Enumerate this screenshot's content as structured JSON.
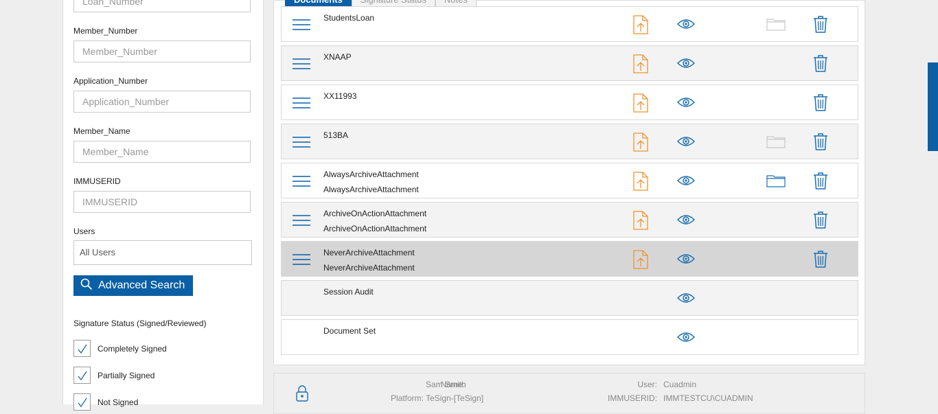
{
  "search_form": {
    "loan_number": {
      "placeholder": "Loan_Number",
      "value": ""
    },
    "member_number": {
      "label": "Member_Number",
      "placeholder": "Member_Number",
      "value": ""
    },
    "application_number": {
      "label": "Application_Number",
      "placeholder": "Application_Number",
      "value": ""
    },
    "member_name": {
      "label": "Member_Name",
      "placeholder": "Member_Name",
      "value": ""
    },
    "immuserid": {
      "label": "IMMUSERID",
      "placeholder": "IMMUSERID",
      "value": ""
    },
    "users": {
      "label": "Users",
      "selected": "All Users"
    },
    "advanced_search_label": "Advanced Search",
    "search_icon": "search-icon"
  },
  "signature_status": {
    "title": "Signature Status (Signed/Reviewed)",
    "options": [
      {
        "label": "Completely Signed",
        "checked": true
      },
      {
        "label": "Partially Signed",
        "checked": true
      },
      {
        "label": "Not Signed",
        "checked": true
      }
    ]
  },
  "tabs": [
    {
      "label": "Documents",
      "active": true
    },
    {
      "label": "Signature Status",
      "active": false
    },
    {
      "label": "Notes",
      "active": false
    }
  ],
  "documents": [
    {
      "name": "StudentsLoan",
      "sub": "",
      "menu": true,
      "upload": true,
      "view": true,
      "folder": "disabled",
      "delete": true
    },
    {
      "name": "XNAAP",
      "sub": "",
      "menu": true,
      "upload": true,
      "view": true,
      "folder": "none",
      "delete": true
    },
    {
      "name": "XX11993",
      "sub": "",
      "menu": true,
      "upload": true,
      "view": true,
      "folder": "none",
      "delete": true
    },
    {
      "name": "513BA",
      "sub": "",
      "menu": true,
      "upload": true,
      "view": true,
      "folder": "disabled",
      "delete": true
    },
    {
      "name": "AlwaysArchiveAttachment",
      "sub": "AlwaysArchiveAttachment",
      "menu": true,
      "upload": true,
      "view": true,
      "folder": "active",
      "delete": true
    },
    {
      "name": "ArchiveOnActionAttachment",
      "sub": "ArchiveOnActionAttachment",
      "menu": true,
      "upload": true,
      "view": true,
      "folder": "none",
      "delete": true
    },
    {
      "name": "NeverArchiveAttachment",
      "sub": "NeverArchiveAttachment",
      "menu": true,
      "upload": true,
      "view": true,
      "folder": "none",
      "delete": true,
      "selected": true
    },
    {
      "name": "Session Audit",
      "sub": "",
      "menu": false,
      "upload": false,
      "view": true,
      "folder": "none",
      "delete": false
    },
    {
      "name": "Document Set",
      "sub": "",
      "menu": false,
      "upload": false,
      "view": true,
      "folder": "none",
      "delete": false
    }
  ],
  "footer": {
    "name_label": "Name:",
    "name_value": "Sam Smith",
    "platform_label": "Platform:",
    "platform_value": "TeSign-[TeSign]",
    "user_label": "User:",
    "user_value": "Cuadmin",
    "immuserid_label": "IMMUSERID:",
    "immuserid_value": "IMMTESTCU\\CUADMIN"
  },
  "colors": {
    "accent": "#0b5fa5",
    "upload_icon": "#f0922e",
    "eye_icon": "#1a6fb0",
    "row_alt": "#f3f3f3",
    "row_selected": "#d6d6d6"
  }
}
